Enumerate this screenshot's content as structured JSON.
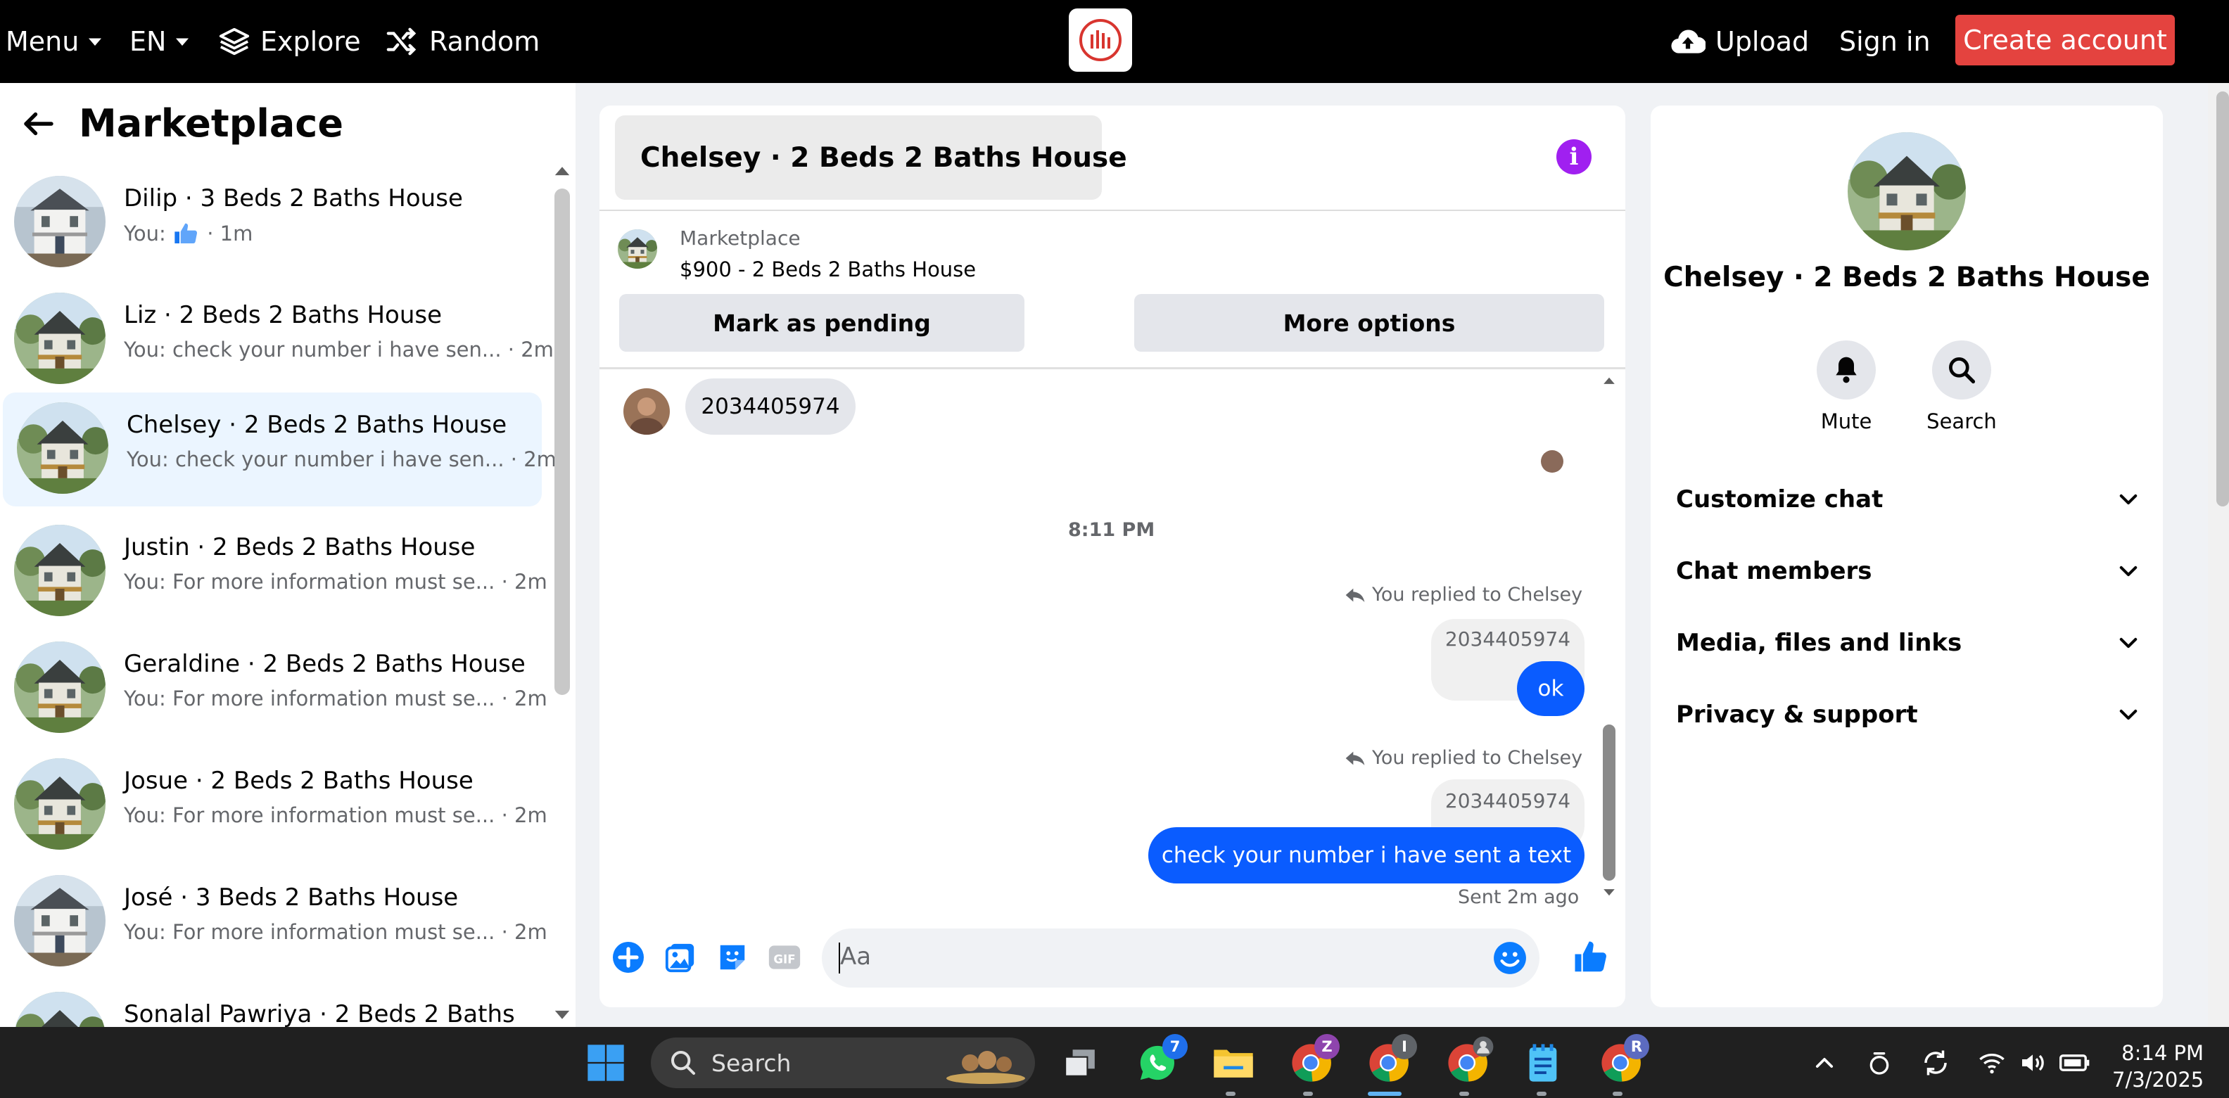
{
  "topbar": {
    "menu_label": "Menu",
    "lang_label": "EN",
    "explore_label": "Explore",
    "random_label": "Random",
    "upload_label": "Upload",
    "signin_label": "Sign in",
    "create_account_label": "Create account"
  },
  "sidebar": {
    "title": "Marketplace",
    "conversations": [
      {
        "title": "Dilip · 3 Beds 2 Baths House",
        "preview_prefix": "You:",
        "preview_suffix": "· 1m"
      },
      {
        "title": "Liz · 2 Beds 2 Baths House",
        "preview": "You: check your number i have sen... · 2m"
      },
      {
        "title": "Chelsey · 2 Beds 2 Baths House",
        "preview": "You: check your number i have sen... · 2m"
      },
      {
        "title": "Justin · 2 Beds 2 Baths House",
        "preview": "You: For more information must se... · 2m"
      },
      {
        "title": "Geraldine · 2 Beds 2 Baths House",
        "preview": "You: For more information must se... · 2m"
      },
      {
        "title": "Josue · 2 Beds 2 Baths House",
        "preview": "You: For more information must se... · 2m"
      },
      {
        "title": "José · 3 Beds 2 Baths House",
        "preview": "You: For more information must se... · 2m"
      },
      {
        "title": "Sonalal Pawriya · 2 Beds 2 Baths"
      }
    ]
  },
  "chat": {
    "header_name": "Chelsey · 2 Beds 2 Baths House",
    "listing_category": "Marketplace",
    "listing_title": "$900 - 2 Beds 2 Baths House",
    "mark_pending_label": "Mark as pending",
    "more_options_label": "More options",
    "messages": {
      "received_number": "2034405974",
      "timestamp": "8:11 PM",
      "reply1_label": "You replied to Chelsey",
      "reply1_quote": "2034405974",
      "reply1_text": "ok",
      "reply2_label": "You replied to Chelsey",
      "reply2_quote": "2034405974",
      "reply2_text": "check your number i have sent a text",
      "status": "Sent 2m ago"
    },
    "composer_placeholder": "Aa"
  },
  "details": {
    "name": "Chelsey · 2 Beds 2 Baths House",
    "mute_label": "Mute",
    "search_label": "Search",
    "sections": [
      "Customize chat",
      "Chat members",
      "Media, files and links",
      "Privacy & support"
    ]
  },
  "taskbar": {
    "search_label": "Search",
    "whatsapp_badge": "7",
    "chrome1_badge": "Z",
    "chrome2_badge": "I",
    "chrome4_badge": "R",
    "time": "8:14 PM",
    "date": "7/3/2025"
  },
  "colors": {
    "brand_red": "#e4433f",
    "messenger_blue": "#0a5cff",
    "info_purple": "#a020f0",
    "selected_bg": "#ebf5ff"
  }
}
